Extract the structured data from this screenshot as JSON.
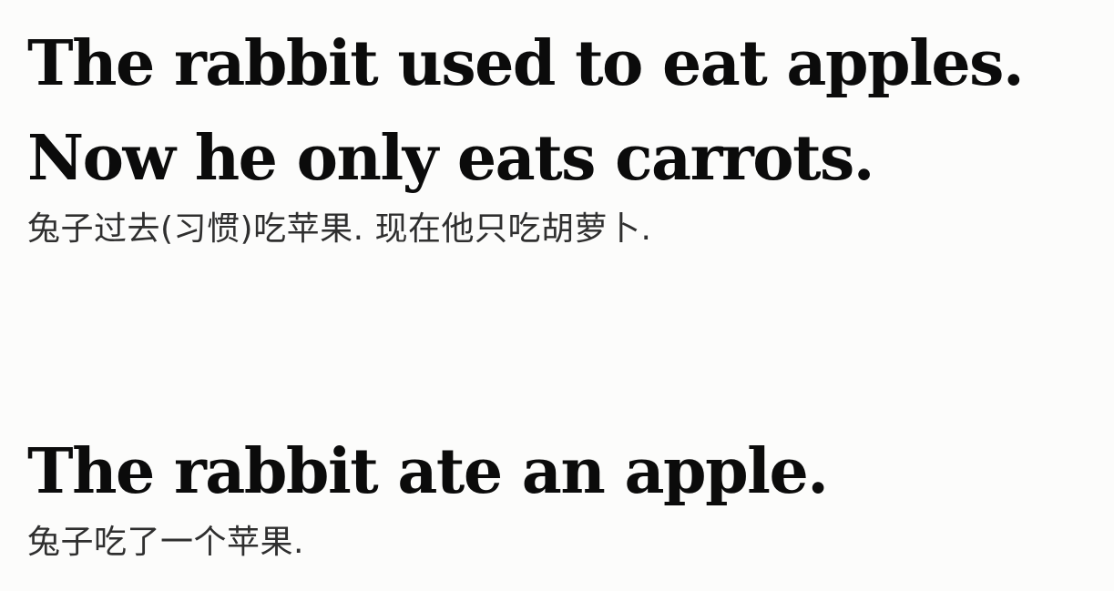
{
  "example_1": {
    "english_line_1": "The rabbit used to eat apples.",
    "english_line_2": "Now he only eats carrots.",
    "chinese": "兔子过去(习惯)吃苹果. 现在他只吃胡萝卜."
  },
  "example_2": {
    "english": "The rabbit ate an apple.",
    "chinese": "兔子吃了一个苹果."
  }
}
